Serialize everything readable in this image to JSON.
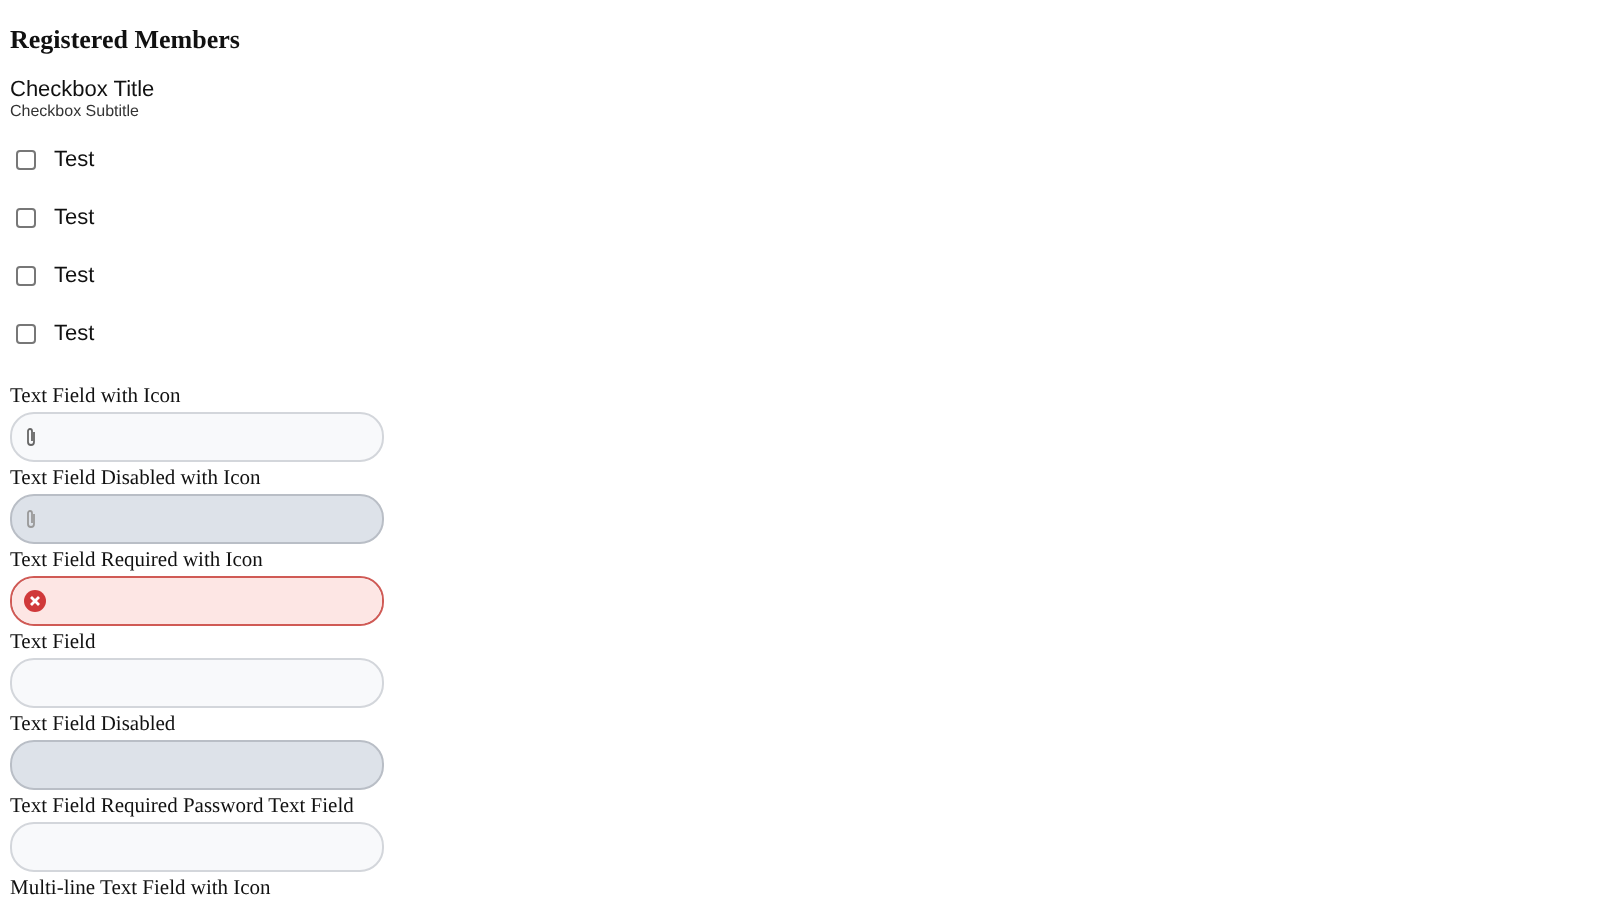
{
  "title": "Registered Members",
  "checkbox_group": {
    "title": "Checkbox Title",
    "subtitle": "Checkbox Subtitle",
    "items": [
      {
        "label": "Test",
        "checked": false
      },
      {
        "label": "Test",
        "checked": false
      },
      {
        "label": "Test",
        "checked": false
      },
      {
        "label": "Test",
        "checked": false
      }
    ]
  },
  "fields": [
    {
      "label": "Text Field with Icon",
      "kind": "attachment",
      "disabled": false,
      "invalid": false
    },
    {
      "label": "Text Field Disabled with Icon",
      "kind": "attachment",
      "disabled": true,
      "invalid": false
    },
    {
      "label": "Text Field Required with Icon",
      "kind": "attachment",
      "disabled": false,
      "invalid": true
    },
    {
      "label": "Text Field",
      "kind": "plain",
      "disabled": false,
      "invalid": false
    },
    {
      "label": "Text Field Disabled",
      "kind": "plain",
      "disabled": true,
      "invalid": false
    },
    {
      "label": "Text Field Required Password Text Field",
      "kind": "plain",
      "disabled": false,
      "invalid": false
    }
  ],
  "next_field_label": "Multi-line Text Field with Icon"
}
